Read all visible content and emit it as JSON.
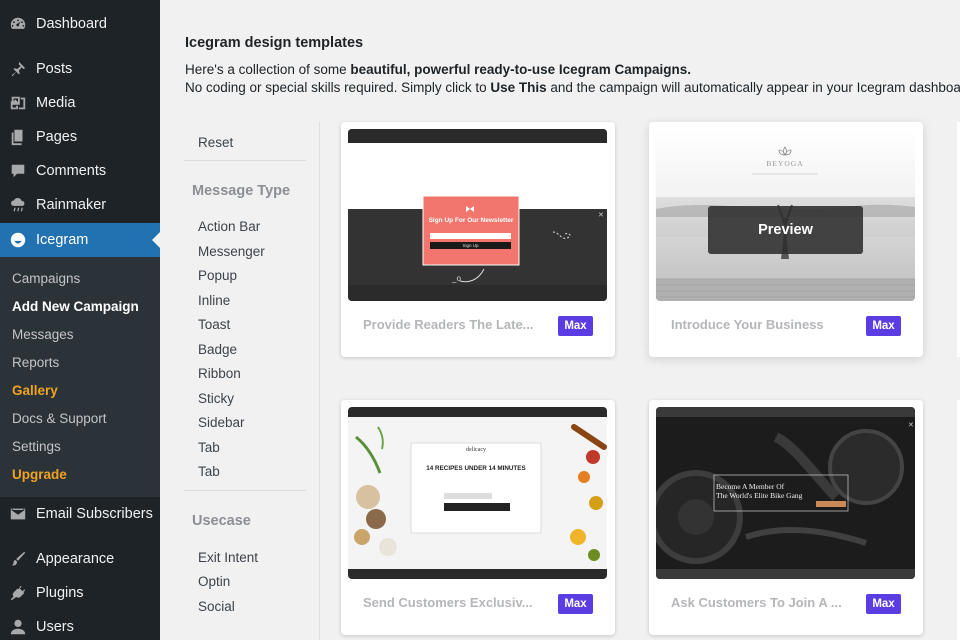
{
  "sidebar": {
    "items": [
      {
        "label": "Dashboard",
        "icon": "dashboard-icon"
      },
      {
        "label": "Posts",
        "icon": "pin-icon"
      },
      {
        "label": "Media",
        "icon": "media-icon"
      },
      {
        "label": "Pages",
        "icon": "pages-icon"
      },
      {
        "label": "Comments",
        "icon": "comment-icon"
      },
      {
        "label": "Rainmaker",
        "icon": "cloud-rain-icon"
      },
      {
        "label": "Icegram",
        "icon": "icegram-icon"
      },
      {
        "label": "Email Subscribers",
        "icon": "email-icon"
      },
      {
        "label": "Appearance",
        "icon": "brush-icon"
      },
      {
        "label": "Plugins",
        "icon": "plug-icon"
      },
      {
        "label": "Users",
        "icon": "user-icon"
      }
    ],
    "submenu": [
      {
        "label": "Campaigns"
      },
      {
        "label": "Add New Campaign"
      },
      {
        "label": "Messages"
      },
      {
        "label": "Reports"
      },
      {
        "label": "Gallery"
      },
      {
        "label": "Docs & Support"
      },
      {
        "label": "Settings"
      },
      {
        "label": "Upgrade"
      }
    ]
  },
  "main": {
    "title": "Icegram design templates",
    "desc1_pre": "Here's a collection of some ",
    "desc1_bold": "beautiful, powerful ready-to-use Icegram Campaigns.",
    "desc2_pre": "No coding or special skills required. Simply click to ",
    "desc2_bold": "Use This",
    "desc2_post": " and the campaign will automatically appear in your Icegram dashboard."
  },
  "filters": {
    "reset": "Reset",
    "message_type_heading": "Message Type",
    "message_types": [
      "Action Bar",
      "Messenger",
      "Popup",
      "Inline",
      "Toast",
      "Badge",
      "Ribbon",
      "Sticky",
      "Sidebar",
      "Tab",
      "Tab"
    ],
    "usecase_heading": "Usecase",
    "usecases": [
      "Exit Intent",
      "Optin",
      "Social"
    ]
  },
  "cards": [
    {
      "title": "Provide Readers The Late...",
      "badge": "Max",
      "thumb_text": "Sign Up For Our Newsletter",
      "thumb_button": "Sign Up"
    },
    {
      "title": "Introduce Your Business",
      "badge": "Max",
      "thumb_text": "BEYOGA",
      "preview_label": "Preview"
    },
    {
      "title": "Send Customers Exclusiv...",
      "badge": "Max",
      "thumb_brand": "delicacy",
      "thumb_text": "14 RECIPES UNDER 14 MINUTES"
    },
    {
      "title": "Ask Customers To Join A ...",
      "badge": "Max",
      "thumb_text_line1": "Become A Member Of",
      "thumb_text_line2": "The World's Elite Bike Gang"
    }
  ],
  "colors": {
    "sidebar_bg": "#1d2327",
    "submenu_bg": "#2c3338",
    "current_bg": "#2271b1",
    "accent_orange": "#f0a223",
    "badge_purple": "#5b3ce2"
  }
}
